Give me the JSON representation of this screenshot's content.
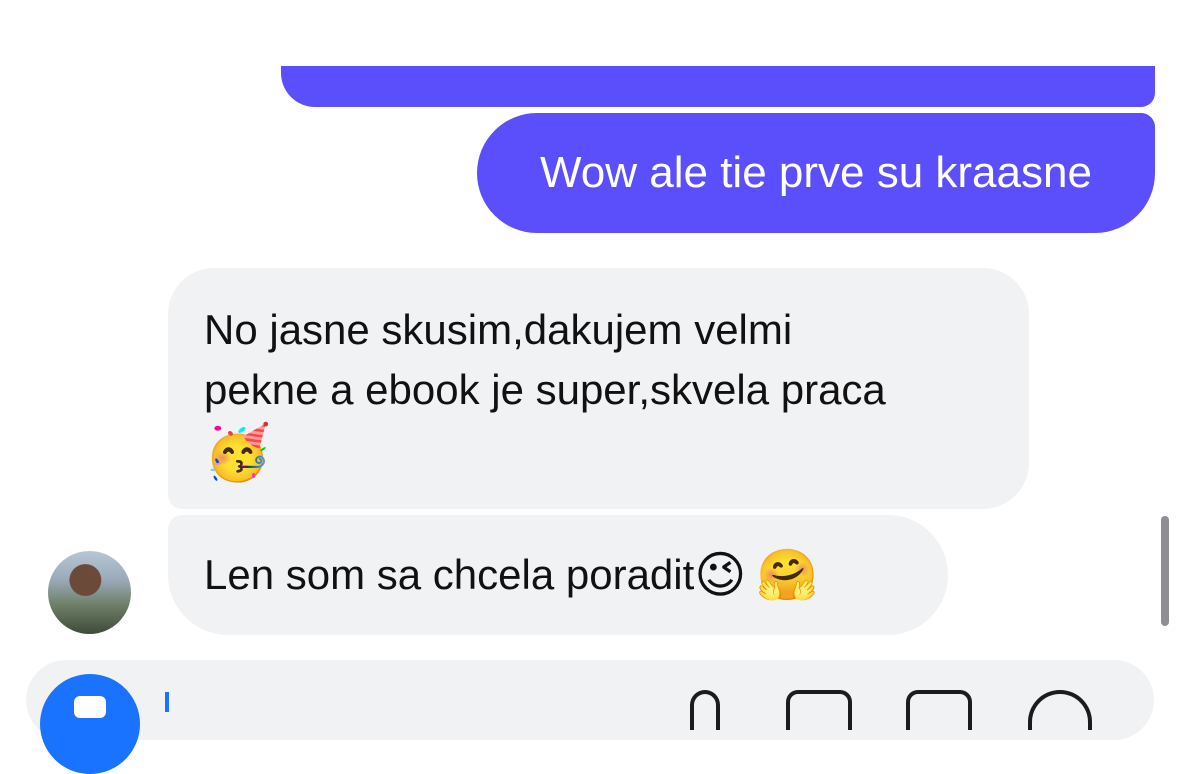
{
  "conversation": {
    "outgoing": [
      {
        "text": ""
      },
      {
        "text": "Wow ale tie prve su kraasne"
      }
    ],
    "incoming": [
      {
        "text_line1": "No jasne skusim,dakujem velmi",
        "text_line2": "pekne a ebook je super,skvela praca",
        "emoji": "🥳"
      },
      {
        "text": "Len som sa chcela poradit",
        "emoji1": "😉",
        "emoji2": "🤗"
      }
    ]
  },
  "composer": {
    "icons": [
      "camera-icon",
      "microphone-icon",
      "photo-icon",
      "sticker-icon",
      "smile-icon"
    ]
  },
  "colors": {
    "outgoing_bubble": "#5b4ffc",
    "incoming_bubble": "#f1f2f4",
    "accent": "#1a73ff"
  }
}
